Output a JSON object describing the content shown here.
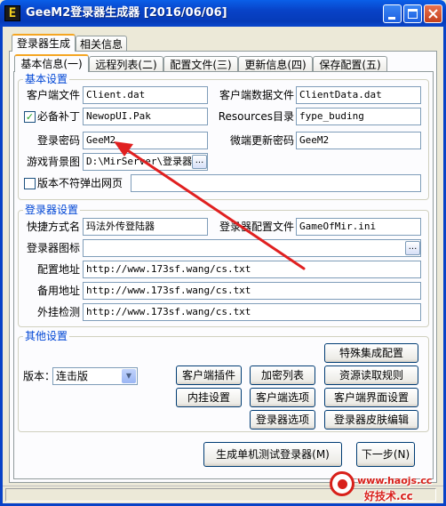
{
  "window": {
    "icon_letter": "E",
    "title": "GeeM2登录器生成器 [2016/06/06]"
  },
  "outer_tabs": [
    "登录器生成",
    "相关信息"
  ],
  "inner_tabs": [
    "基本信息(一)",
    "远程列表(二)",
    "配置文件(三)",
    "更新信息(四)",
    "保存配置(五)"
  ],
  "basic": {
    "legend": "基本设置",
    "client_file_label": "客户端文件",
    "client_file_value": "Client.dat",
    "client_data_label": "客户端数据文件",
    "client_data_value": "ClientData.dat",
    "patch_label": "必备补丁",
    "patch_checked": true,
    "patch_value": "NewopUI.Pak",
    "resources_label": "Resources目录",
    "resources_value": "fype_buding",
    "password_label": "登录密码",
    "password_value": "GeeM2",
    "update_password_label": "微端更新密码",
    "update_password_value": "GeeM2",
    "background_label": "游戏背景图",
    "background_value": "D:\\MirServer\\登录器\\",
    "background_browse": "...",
    "no_popup_label": "版本不符弹出网页",
    "no_popup_checked": false,
    "no_popup_value": ""
  },
  "launcher": {
    "legend": "登录器设置",
    "shortcut_label": "快捷方式名",
    "shortcut_value": "玛法外传登陆器",
    "config_label": "登录器配置文件",
    "config_value": "GameOfMir.ini",
    "icon_label": "登录器图标",
    "icon_value": "",
    "icon_browse": "...",
    "config_url_label": "配置地址",
    "config_url_value": "http://www.173sf.wang/cs.txt",
    "backup_url_label": "备用地址",
    "backup_url_value": "http://www.173sf.wang/cs.txt",
    "plugin_check_label": "外挂检测",
    "plugin_check_value": "http://www.173sf.wang/cs.txt"
  },
  "other": {
    "legend": "其他设置",
    "version_label": "版本：",
    "version_value": "连击版",
    "buttons": {
      "special": "特殊集成配置",
      "client_plugin": "客户端插件",
      "encrypt_list": "加密列表",
      "resource_rules": "资源读取规则",
      "builtin_plugin": "内挂设置",
      "client_options": "客户端选项",
      "client_ui": "客户端界面设置",
      "launcher_options": "登录器选项",
      "launcher_skin": "登录器皮肤编辑"
    }
  },
  "footer": {
    "generate": "生成单机测试登录器(M)",
    "next": "下一步(N)"
  },
  "watermark": {
    "url": "www.haojs.cc",
    "text": "好技术.cc"
  },
  "colors": {
    "title_bar": "#0842c7",
    "legend_text": "#0046d5",
    "annotation_arrow": "#e02020"
  }
}
